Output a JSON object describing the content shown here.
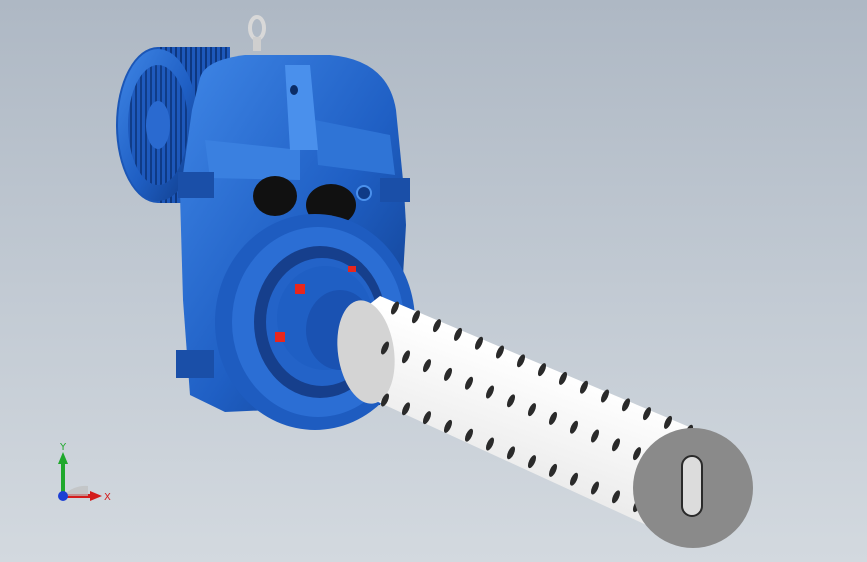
{
  "viewport": {
    "colors": {
      "background_top": "#aeb8c4",
      "background_bottom": "#d3d9df",
      "housing_blue": "#1f5fc4",
      "housing_dark": "#0f3a86",
      "housing_light": "#3f86e6",
      "shaft_white": "#ececec",
      "shaft_end_grey": "#8a8a8a",
      "accent_red": "#e8261c"
    }
  },
  "triad": {
    "x_label": "X",
    "y_label": "Y",
    "x_color": "#d41c1c",
    "y_color": "#1fa82c",
    "z_color": "#1c3fd4"
  }
}
